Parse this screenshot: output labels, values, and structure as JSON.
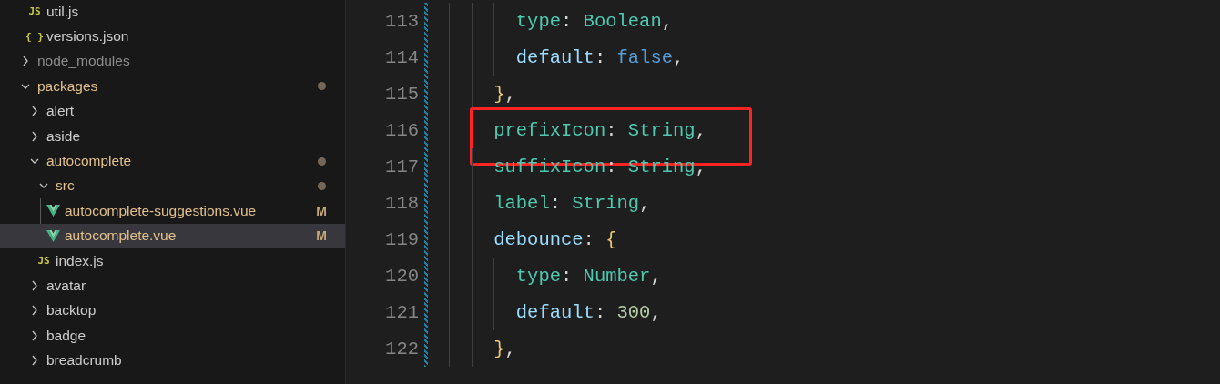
{
  "explorer": {
    "tree": [
      {
        "children": [
          {
            "kind": "js",
            "label": "util.js",
            "icon_text": "JS",
            "modified": false,
            "ignored": false
          },
          {
            "kind": "json",
            "label": "versions.json",
            "icon_text": "{ }",
            "modified": false,
            "ignored": false
          }
        ]
      },
      {
        "kind": "folder",
        "label": "node_modules",
        "expanded": false,
        "modified": false,
        "ignored": true
      },
      {
        "kind": "folder",
        "label": "packages",
        "expanded": true,
        "modified": true,
        "ignored": false,
        "change_dot": true,
        "children": [
          {
            "kind": "folder",
            "label": "alert",
            "expanded": false,
            "modified": false,
            "ignored": false
          },
          {
            "kind": "folder",
            "label": "aside",
            "expanded": false,
            "modified": false,
            "ignored": false
          },
          {
            "kind": "folder",
            "label": "autocomplete",
            "expanded": true,
            "modified": true,
            "ignored": false,
            "change_dot": true,
            "children": [
              {
                "kind": "folder",
                "label": "src",
                "expanded": true,
                "modified": true,
                "ignored": false,
                "change_dot": true,
                "indent_guide": true,
                "children": [
                  {
                    "kind": "vue",
                    "label": "autocomplete-suggestions.vue",
                    "modified": true,
                    "ignored": false,
                    "badge": "M",
                    "selected": false
                  },
                  {
                    "kind": "vue",
                    "label": "autocomplete.vue",
                    "modified": true,
                    "ignored": false,
                    "badge": "M",
                    "selected": true
                  }
                ]
              },
              {
                "kind": "js",
                "label": "index.js",
                "icon_text": "JS",
                "modified": false,
                "ignored": false
              }
            ]
          },
          {
            "kind": "folder",
            "label": "avatar",
            "expanded": false,
            "modified": false,
            "ignored": false
          },
          {
            "kind": "folder",
            "label": "backtop",
            "expanded": false,
            "modified": false,
            "ignored": false
          },
          {
            "kind": "folder",
            "label": "badge",
            "expanded": false,
            "modified": false,
            "ignored": false
          },
          {
            "kind": "folder",
            "label": "breadcrumb",
            "expanded": false,
            "modified": false,
            "ignored": false
          }
        ]
      }
    ]
  },
  "editor": {
    "lines": [
      {
        "children": [
          {
            "number": "113",
            "modified": true,
            "highlighted": false,
            "tokens": [
              {
                "text": "type",
                "kind": "class"
              },
              {
                "text": ": ",
                "kind": "punct"
              },
              {
                "text": "Boolean",
                "kind": "class"
              },
              {
                "text": ",",
                "kind": "punct"
              }
            ]
          },
          {
            "number": "114",
            "modified": true,
            "highlighted": false,
            "tokens": [
              {
                "text": "default",
                "kind": "property"
              },
              {
                "text": ": ",
                "kind": "punct"
              },
              {
                "text": "false",
                "kind": "keyword"
              },
              {
                "text": ",",
                "kind": "punct"
              }
            ]
          }
        ]
      },
      {
        "number": "115",
        "modified": true,
        "highlighted": false,
        "tokens": [
          {
            "text": "}",
            "kind": "bracket"
          },
          {
            "text": ",",
            "kind": "punct"
          }
        ]
      },
      {
        "number": "116",
        "modified": true,
        "highlighted": true,
        "tokens": [
          {
            "text": "prefixIcon",
            "kind": "class"
          },
          {
            "text": ": ",
            "kind": "punct"
          },
          {
            "text": "String",
            "kind": "class"
          },
          {
            "text": ",",
            "kind": "punct"
          }
        ]
      },
      {
        "number": "117",
        "modified": true,
        "highlighted": false,
        "tokens": [
          {
            "text": "suffixIcon",
            "kind": "class"
          },
          {
            "text": ": ",
            "kind": "punct"
          },
          {
            "text": "String",
            "kind": "class"
          },
          {
            "text": ",",
            "kind": "punct"
          }
        ]
      },
      {
        "number": "118",
        "modified": true,
        "highlighted": false,
        "tokens": [
          {
            "text": "label",
            "kind": "class"
          },
          {
            "text": ": ",
            "kind": "punct"
          },
          {
            "text": "String",
            "kind": "class"
          },
          {
            "text": ",",
            "kind": "punct"
          }
        ]
      },
      {
        "number": "119",
        "modified": true,
        "highlighted": false,
        "tokens": [
          {
            "text": "debounce",
            "kind": "property"
          },
          {
            "text": ": ",
            "kind": "punct"
          },
          {
            "text": "{",
            "kind": "bracket"
          }
        ],
        "children": [
          {
            "number": "120",
            "modified": true,
            "highlighted": false,
            "tokens": [
              {
                "text": "type",
                "kind": "class"
              },
              {
                "text": ": ",
                "kind": "punct"
              },
              {
                "text": "Number",
                "kind": "class"
              },
              {
                "text": ",",
                "kind": "punct"
              }
            ]
          },
          {
            "number": "121",
            "modified": true,
            "highlighted": false,
            "tokens": [
              {
                "text": "default",
                "kind": "property"
              },
              {
                "text": ": ",
                "kind": "punct"
              },
              {
                "text": "300",
                "kind": "number"
              },
              {
                "text": ",",
                "kind": "punct"
              }
            ]
          }
        ]
      },
      {
        "number": "122",
        "modified": true,
        "highlighted": false,
        "tokens": [
          {
            "text": "}",
            "kind": "bracket"
          },
          {
            "text": ",",
            "kind": "punct"
          }
        ]
      }
    ]
  }
}
